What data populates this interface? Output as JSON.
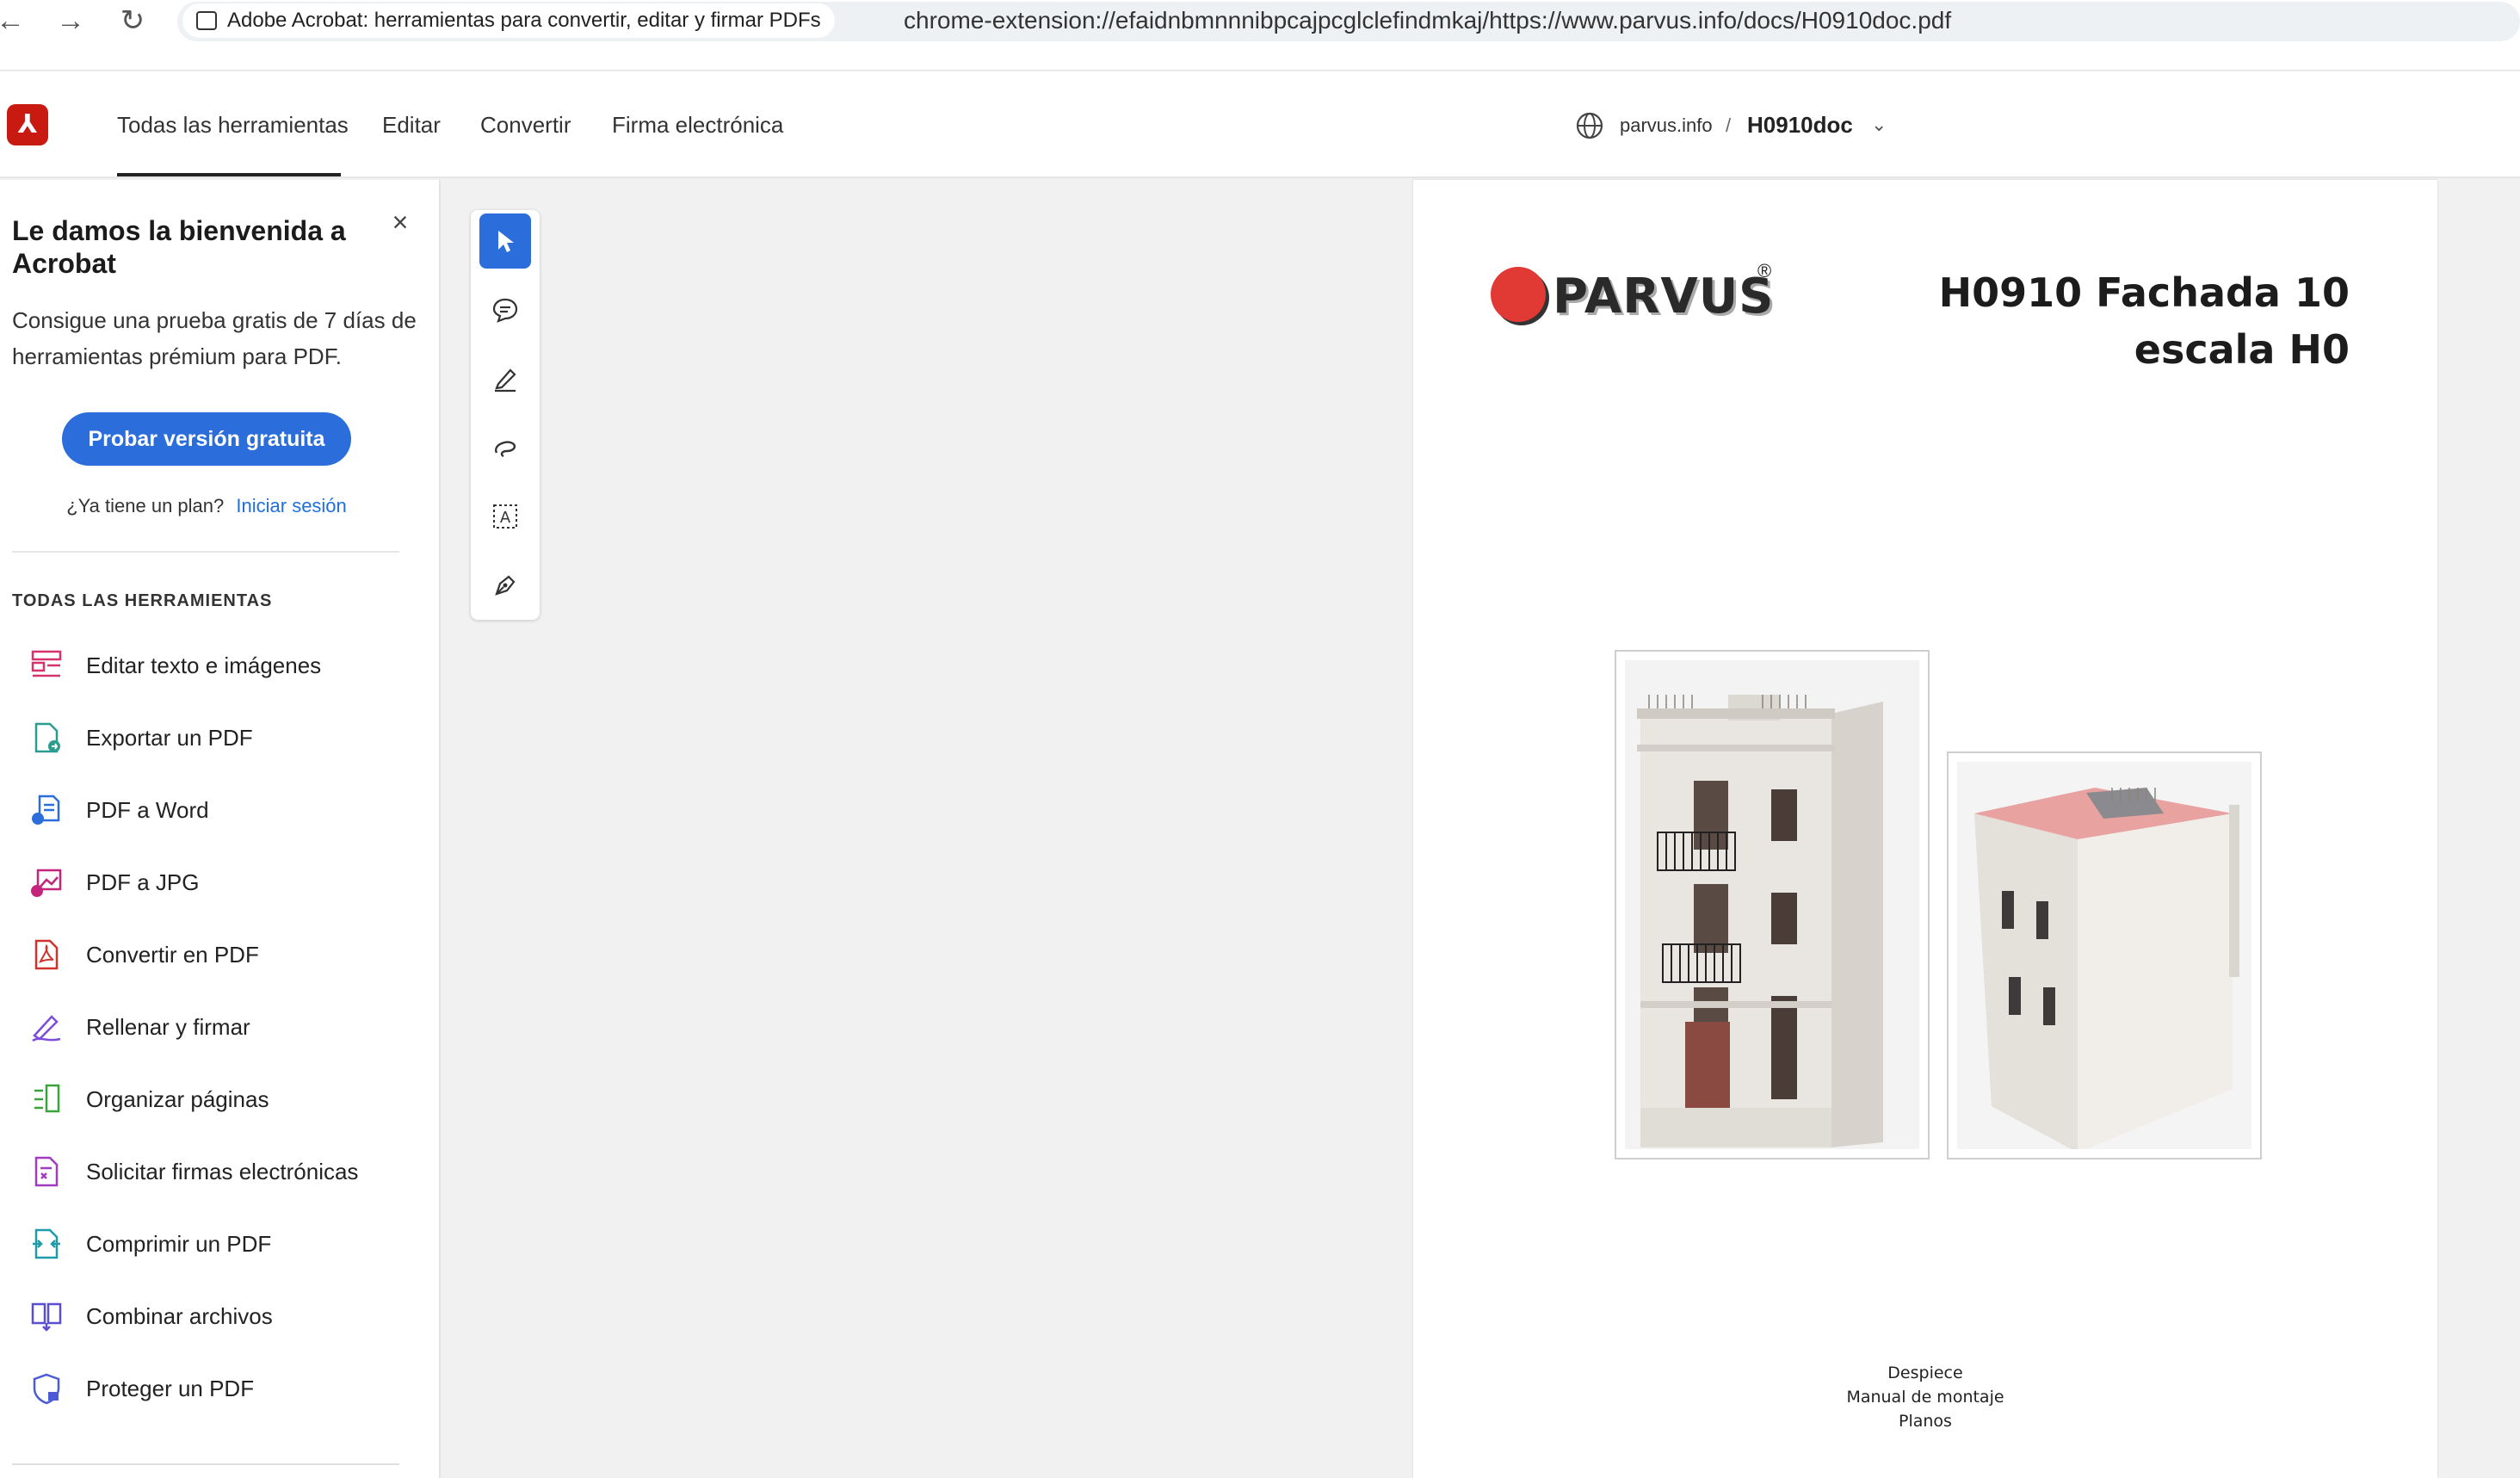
{
  "browser": {
    "tab_title": "Adobe Acrobat: herramientas para convertir, editar y firmar PDFs",
    "url": "chrome-extension://efaidnbmnnnibpcajpcglclefindmkaj/https://www.parvus.info/docs/H0910doc.pdf",
    "back_glyph": "←",
    "forward_glyph": "→",
    "reload_glyph": "↻"
  },
  "appbar": {
    "logo_glyph": "⅄",
    "tabs": [
      {
        "label": "Todas las herramientas",
        "active": true
      },
      {
        "label": "Editar"
      },
      {
        "label": "Convertir"
      },
      {
        "label": "Firma electrónica"
      }
    ],
    "breadcrumb": {
      "site": "parvus.info",
      "separator": "/",
      "doc": "H0910doc",
      "chevron": "⌄"
    }
  },
  "leftpanel": {
    "welcome_title": "Le damos la bienvenida a Acrobat",
    "close_glyph": "×",
    "welcome_body": "Consigue una prueba gratis de 7 días de herramientas prémium para PDF.",
    "trial_button": "Probar versión gratuita",
    "plan_question": "¿Ya tiene un plan?",
    "signin_link": "Iniciar sesión",
    "section_heading": "TODAS LAS HERRAMIENTAS",
    "tools": [
      {
        "label": "Editar texto e imágenes",
        "icon": "edit-text-icon",
        "color": "#d6336c"
      },
      {
        "label": "Exportar un PDF",
        "icon": "export-pdf-icon",
        "color": "#2a9d8f"
      },
      {
        "label": "PDF a Word",
        "icon": "pdf-to-word-icon",
        "color": "#2b6edb"
      },
      {
        "label": "PDF a JPG",
        "icon": "pdf-to-jpg-icon",
        "color": "#c2257a"
      },
      {
        "label": "Convertir en PDF",
        "icon": "convert-pdf-icon",
        "color": "#d2322d"
      },
      {
        "label": "Rellenar y firmar",
        "icon": "fill-sign-icon",
        "color": "#7b4dd8"
      },
      {
        "label": "Organizar páginas",
        "icon": "organize-pages-icon",
        "color": "#3aa23a"
      },
      {
        "label": "Solicitar firmas electrónicas",
        "icon": "request-signatures-icon",
        "color": "#a33ac2"
      },
      {
        "label": "Comprimir un PDF",
        "icon": "compress-pdf-icon",
        "color": "#1f9aa8"
      },
      {
        "label": "Combinar archivos",
        "icon": "combine-files-icon",
        "color": "#5a4fd1"
      },
      {
        "label": "Proteger un PDF",
        "icon": "protect-pdf-icon",
        "color": "#4b5bd6"
      }
    ]
  },
  "vtoolbar": {
    "tools": [
      {
        "name": "select-tool",
        "active": true
      },
      {
        "name": "comment-tool"
      },
      {
        "name": "highlight-tool"
      },
      {
        "name": "draw-tool"
      },
      {
        "name": "text-select-tool",
        "glyph": "A"
      },
      {
        "name": "sign-tool"
      }
    ]
  },
  "pdf": {
    "logo_word": "PARVUS",
    "logo_reg": "®",
    "title_line1": "H0910 Fachada 10",
    "title_line2": "escala H0",
    "footer": [
      "Despiece",
      "Manual de montaje",
      "Planos"
    ]
  },
  "colors": {
    "accent": "#2b6edb",
    "acrobat_red": "#c91a12",
    "parvus_red": "#e13a34"
  }
}
